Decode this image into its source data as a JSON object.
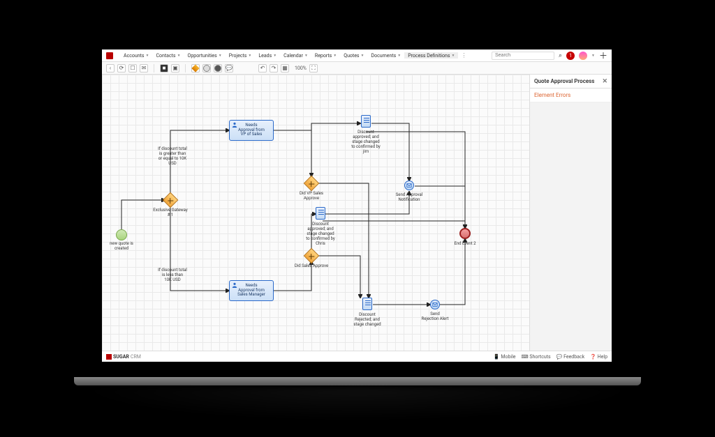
{
  "nav": {
    "items": [
      {
        "label": "Accounts"
      },
      {
        "label": "Contacts"
      },
      {
        "label": "Opportunities"
      },
      {
        "label": "Projects"
      },
      {
        "label": "Leads"
      },
      {
        "label": "Calendar"
      },
      {
        "label": "Reports"
      },
      {
        "label": "Quotes"
      },
      {
        "label": "Documents"
      },
      {
        "label": "Process Definitions"
      }
    ],
    "search_placeholder": "Search",
    "notifications": "1"
  },
  "toolbar": {
    "zoom": "100%"
  },
  "sidebar": {
    "title": "Quote Approval Process",
    "tab": "Element Errors"
  },
  "diagram": {
    "start": {
      "label": "new quote is\ncreated"
    },
    "gateways": {
      "g1": "Exclusive Gateway\n# 1",
      "g2": "Did VP Sales\nApprove",
      "g3": "Did Sales Approve"
    },
    "conditions": {
      "c1": "If discount total\nis greater than\nor equal to 10K\nUSD",
      "c2": "If discount total\nis less than\n10K USD"
    },
    "tasks": {
      "t1": "Needs\nApproval from\nVP of Sales",
      "t2": "Needs\nApproval from\nSales Manager"
    },
    "docs": {
      "d1": "Discount\napproved; and\nstage changed\nto confirmed by\njim",
      "d2": "Discount\napproved; and\nstage changed\nto confirmed by\nChris",
      "d3": "Discount\nRejected; and\nstage changed"
    },
    "interm": {
      "i1": "Send Approval\nNotification",
      "i2": "Send\nRejection Alert"
    },
    "end": {
      "label": "End Event 2"
    }
  },
  "footer": {
    "brand1": "SUGAR",
    "brand2": "CRM",
    "links": [
      "Mobile",
      "Shortcuts",
      "Feedback",
      "Help"
    ]
  }
}
